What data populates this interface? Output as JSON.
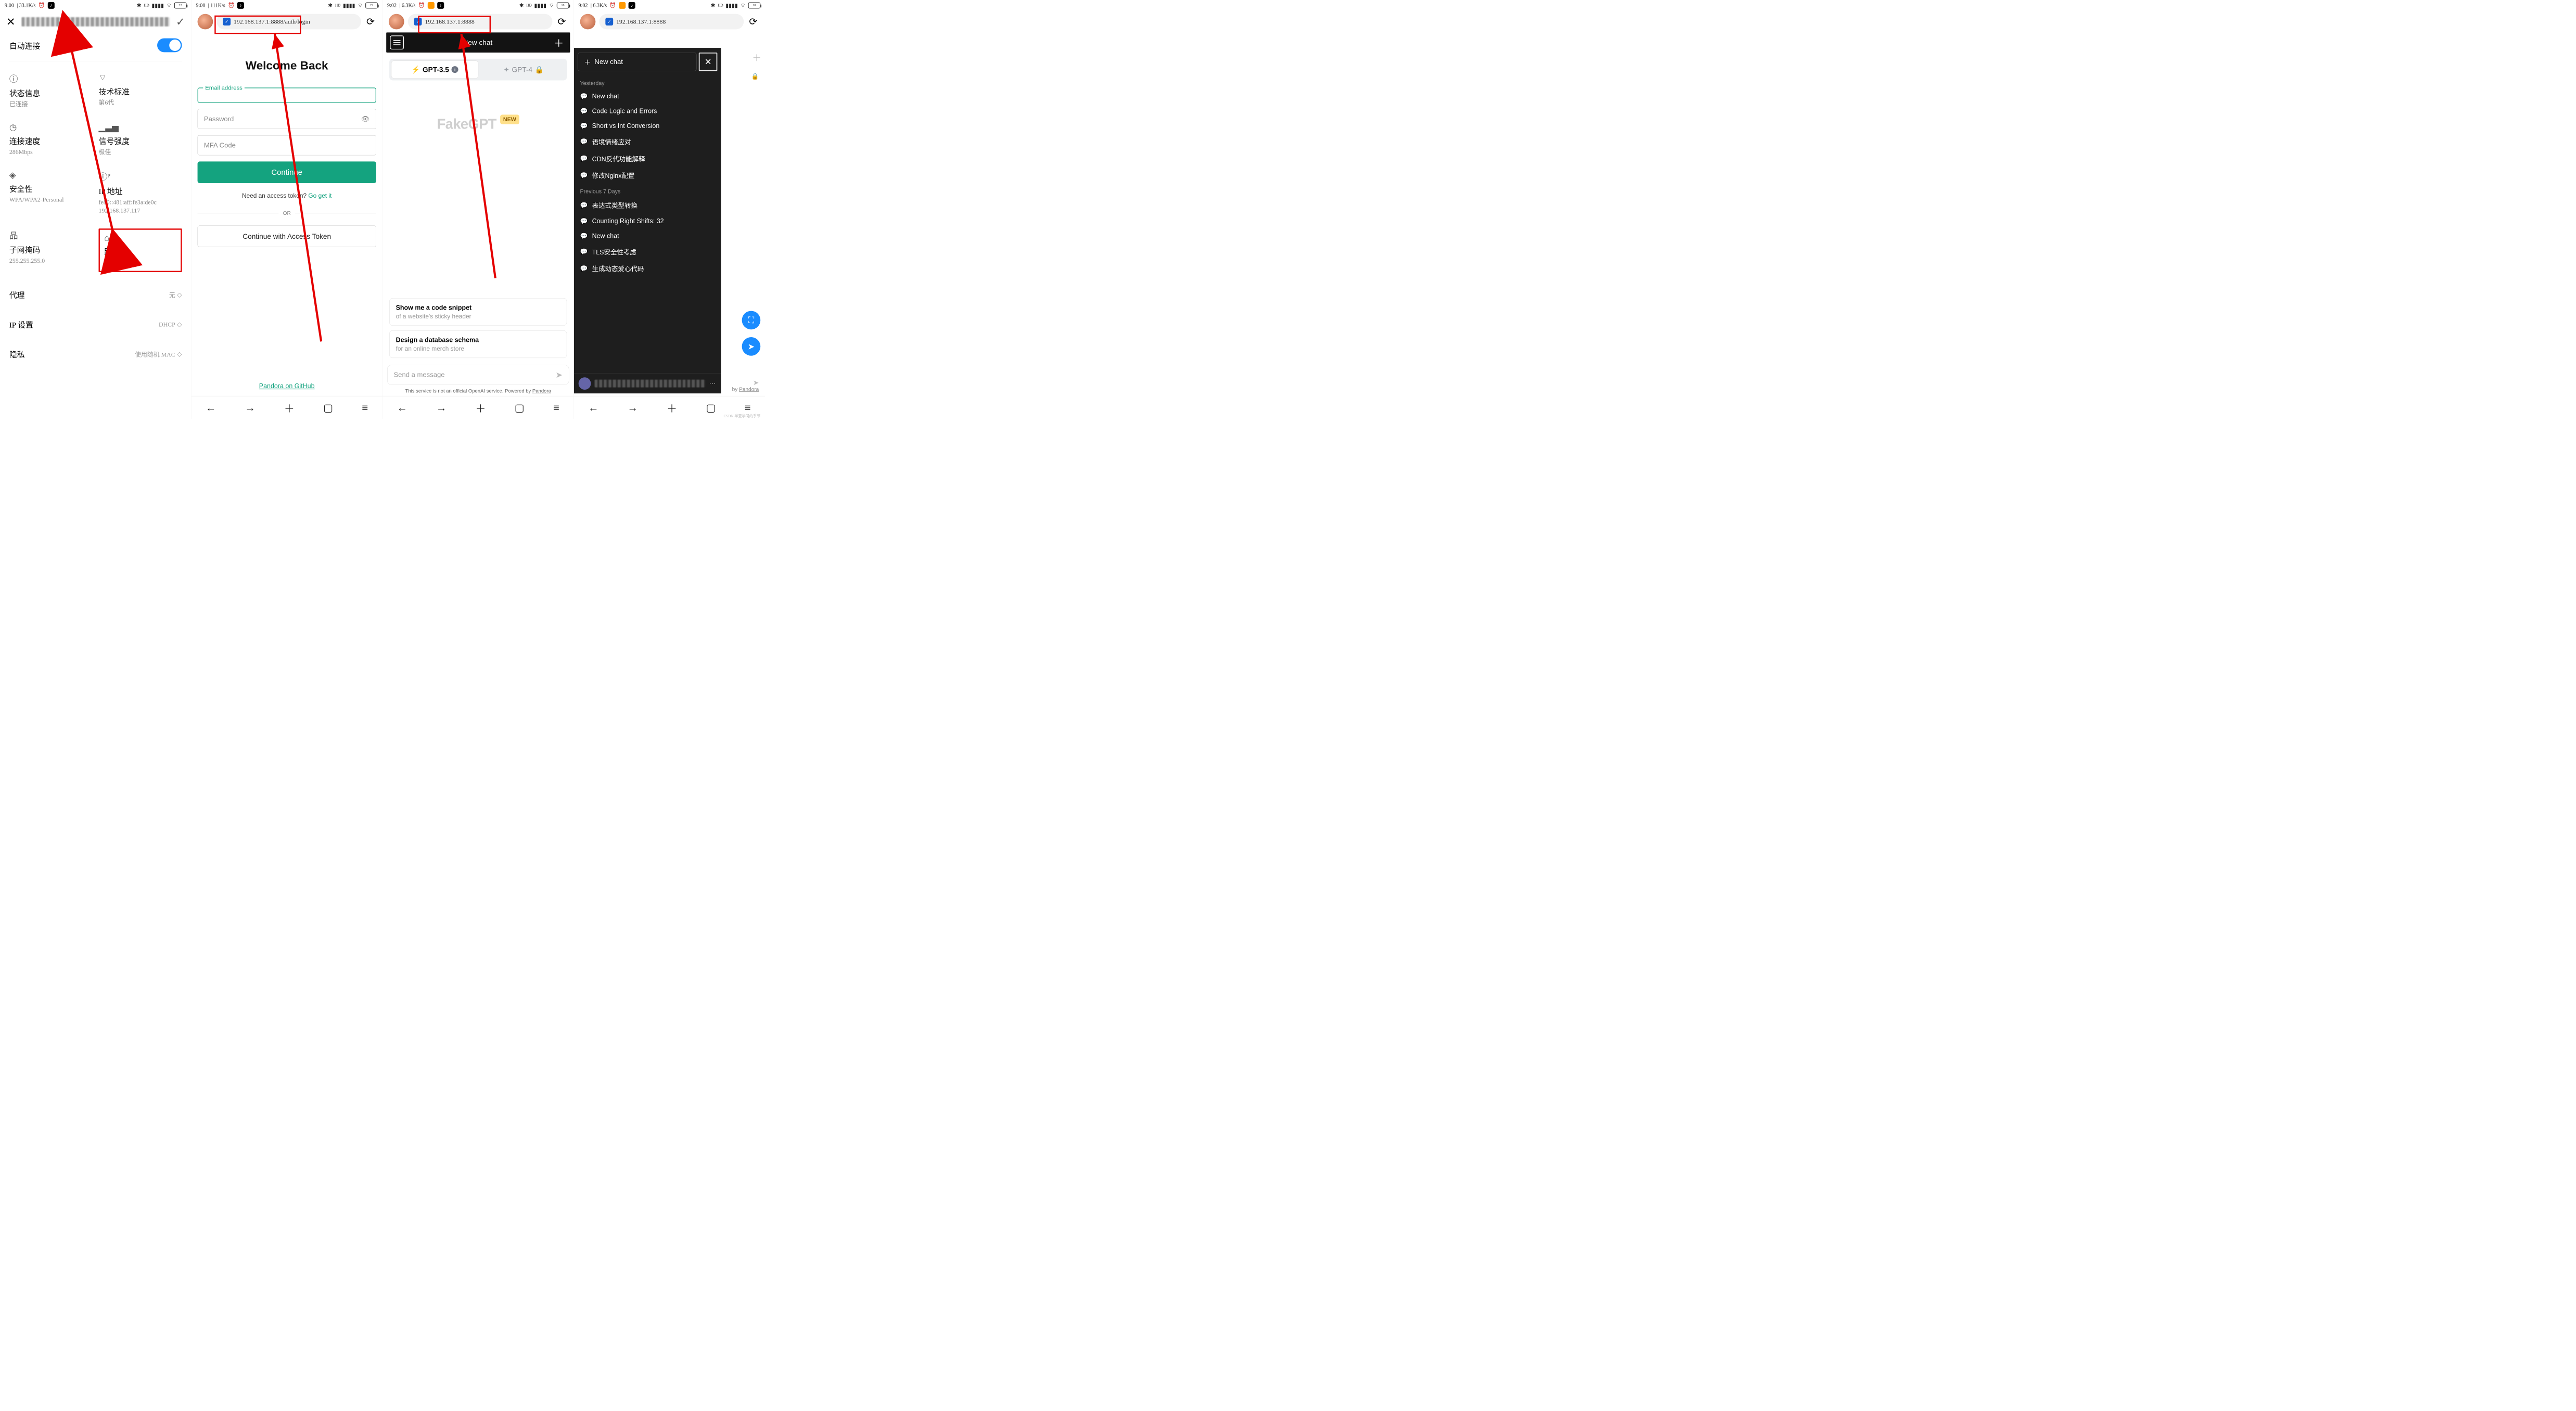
{
  "screen1": {
    "status": {
      "time": "9:00",
      "net": "| 33.1K/s",
      "icons": [
        "⏰",
        "♪"
      ],
      "right": [
        "*",
        "ᴴᴰ",
        "📶",
        "📡",
        "🔋"
      ],
      "batt": "22"
    },
    "autoConnect": "自动连接",
    "tiles": {
      "status": {
        "label": "状态信息",
        "sub": "已连接"
      },
      "standard": {
        "label": "技术标准",
        "sub": "第6代"
      },
      "linkspeed": {
        "label": "连接速度",
        "sub": "286Mbps"
      },
      "signal": {
        "label": "信号强度",
        "sub": "极佳"
      },
      "security": {
        "label": "安全性",
        "sub": "WPA/WPA2-Personal"
      },
      "ip": {
        "label": "IP 地址",
        "sub1": "fe80::481:aff:fe3a:de0c",
        "sub2": "192.168.137.117"
      },
      "subnet": {
        "label": "子网掩码",
        "sub": "255.255.255.0"
      },
      "router": {
        "label": "路由器",
        "sub": "192.168.137.1"
      }
    },
    "settings": {
      "proxy": {
        "label": "代理",
        "value": "无"
      },
      "ipset": {
        "label": "IP 设置",
        "value": "DHCP"
      },
      "privacy": {
        "label": "隐私",
        "value": "使用随机 MAC"
      }
    }
  },
  "screen2": {
    "status": {
      "time": "9:00",
      "net": "| 111K/s",
      "batt": "22"
    },
    "url": "192.168.137.1:8888/auth/login",
    "title": "Welcome Back",
    "emailLegend": "Email address",
    "password": "Password",
    "mfa": "MFA Code",
    "continue": "Continue",
    "needToken": "Need an access token? ",
    "goget": "Go get it",
    "or": "OR",
    "accessBtn": "Continue with Access Token",
    "ghlink": "Pandora on GitHub"
  },
  "screen3": {
    "status": {
      "time": "9:02",
      "net": "| 6.3K/s",
      "batt": "18"
    },
    "url": "192.168.137.1:8888",
    "chatbar": "New chat",
    "gpt35": "GPT-3.5",
    "gpt4": "GPT-4",
    "brand": "FakeGPT",
    "newpill": "NEW",
    "sugg1": {
      "t": "Show me a code snippet",
      "s": "of a website's sticky header"
    },
    "sugg2": {
      "t": "Design a database schema",
      "s": "for an online merch store"
    },
    "placeholder": "Send a message",
    "disclaimer": "This service is not an official OpenAI service. Powered by ",
    "pandora": "Pandora"
  },
  "screen4": {
    "status": {
      "time": "9:02",
      "net": "| 6.3K/s",
      "batt": "18"
    },
    "url": "192.168.137.1:8888",
    "newchatBtn": "New chat",
    "sections": {
      "yesterday": "Yesterday",
      "prev7": "Previous 7 Days"
    },
    "conv_y": [
      "New chat",
      "Code Logic and Errors",
      "Short vs Int Conversion",
      "语境情绪应对",
      "CDN反代功能解释",
      "修改Nginx配置"
    ],
    "conv_p": [
      "表达式类型转换",
      "Counting Right Shifts: 32",
      "New chat",
      "TLS安全性考虑",
      "生成动态爱心代码"
    ],
    "poweredBy": "by ",
    "pandora": "Pandora"
  }
}
